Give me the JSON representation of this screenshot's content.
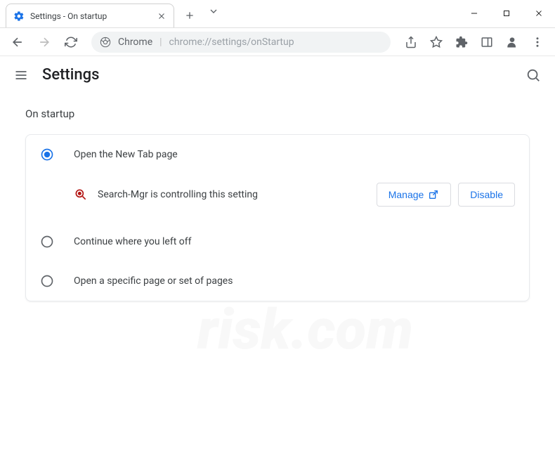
{
  "window": {
    "tab_title": "Settings - On startup",
    "address_prefix": "Chrome",
    "address_url": "chrome://settings/onStartup"
  },
  "header": {
    "title": "Settings"
  },
  "section": {
    "title": "On startup",
    "options": [
      {
        "label": "Open the New Tab page",
        "selected": true
      },
      {
        "label": "Continue where you left off",
        "selected": false
      },
      {
        "label": "Open a specific page or set of pages",
        "selected": false
      }
    ],
    "notice": {
      "text": "Search-Mgr is controlling this setting",
      "manage_label": "Manage",
      "disable_label": "Disable"
    }
  }
}
